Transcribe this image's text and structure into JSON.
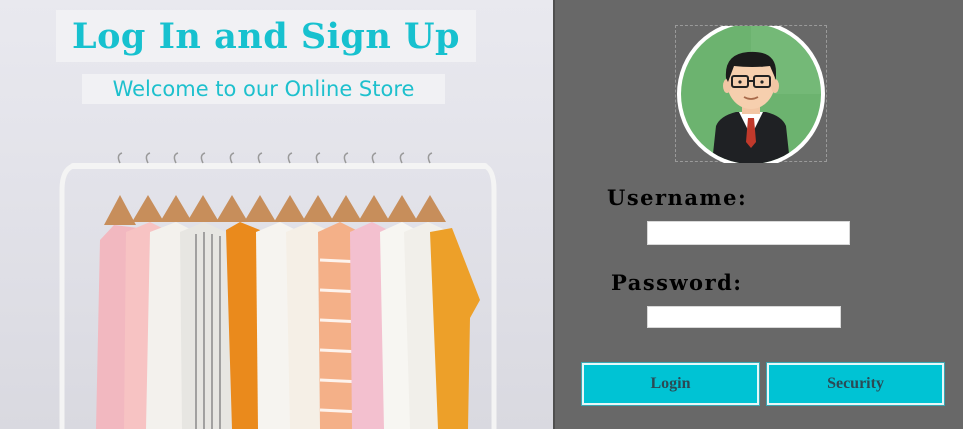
{
  "header": {
    "title": "Log In and Sign Up",
    "subtitle": "Welcome to our Online Store"
  },
  "form": {
    "username_label": "Username:",
    "username_value": "",
    "password_label": "Password:",
    "password_value": ""
  },
  "buttons": {
    "login_label": "Login",
    "security_label": "Security"
  },
  "icons": {
    "avatar": "businessman-avatar-icon",
    "banner": "clothes-rack-illustration"
  },
  "colors": {
    "accent": "#00c3d4",
    "title_text": "#17c1cf",
    "panel_bg": "#686868",
    "avatar_bg": "#6cb36f"
  }
}
